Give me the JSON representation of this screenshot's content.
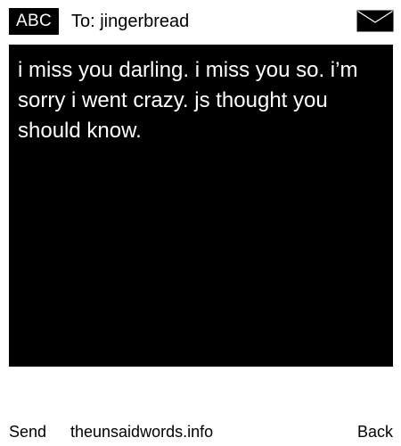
{
  "header": {
    "mode_label": "ABC",
    "recipient": "To: jingerbread",
    "mail_icon": "envelope-icon"
  },
  "message": {
    "text": "i miss you darling. i miss you so. i’m sorry i went crazy. js thought you should know."
  },
  "footer": {
    "send_label": "Send",
    "site_label": "theunsaidwords.info",
    "back_label": "Back"
  },
  "colors": {
    "background": "#ffffff",
    "message_background": "#000000",
    "message_text": "#ffffff",
    "text": "#000000"
  }
}
